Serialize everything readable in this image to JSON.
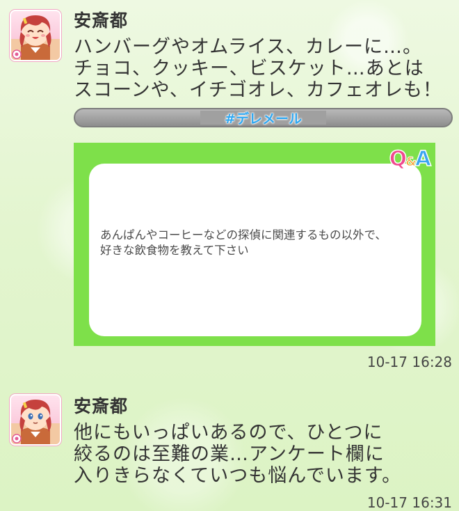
{
  "messages": [
    {
      "sender": "安斎都",
      "avatar": "smiling-girl-avatar-icon",
      "text": "ハンバーグやオムライス、カレーに…。\nチョコ、クッキー、ビスケット…あとは\nスコーンや、イチゴオレ、カフェオレも！",
      "hashtag": "#デレメール",
      "qa": {
        "badge_q": "Q",
        "badge_amp": "&",
        "badge_a": "A",
        "question": "あんぱんやコーヒーなどの探偵に関連するもの以外で、\n好きな飲食物を教えて下さい"
      },
      "timestamp": "10-17 16:28"
    },
    {
      "sender": "安斎都",
      "avatar": "girl-avatar-icon",
      "text": "他にもいっぱいあるので、ひとつに\n絞るのは至難の業…アンケート欄に\n入りきらなくていつも悩んでいます。",
      "timestamp": "10-17 16:31"
    }
  ],
  "colors": {
    "qa_frame": "#7ee04a",
    "hashtag_text": "#2fa8f2",
    "avatar_border": "#f2a6c4"
  }
}
